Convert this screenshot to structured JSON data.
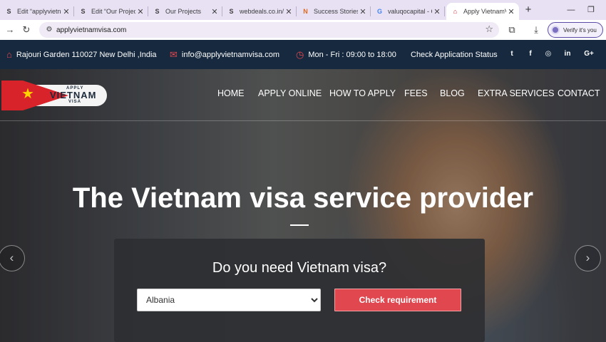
{
  "browser": {
    "tabs": [
      {
        "title": "Edit “applyvietna",
        "icon": "S"
      },
      {
        "title": "Edit “Our Projects",
        "icon": "S"
      },
      {
        "title": "Our Projects",
        "icon": "S"
      },
      {
        "title": "webdeals.co.in/p",
        "icon": "S"
      },
      {
        "title": "Success Stories",
        "icon": "N"
      },
      {
        "title": "valuqocapital - C",
        "icon": "G"
      },
      {
        "title": "Apply VietnamVi",
        "icon": "⌂"
      }
    ],
    "url": "applyvietnamvisa.com",
    "verify_label": "Verify it's you"
  },
  "infobar": {
    "address": "Rajouri Garden 110027 New Delhi ,India",
    "email": "info@applyvietnamvisa.com",
    "hours": "Mon - Fri : 09:00 to 18:00",
    "check_status": "Check Application Status",
    "social": [
      "t",
      "f",
      "◎",
      "in",
      "G+"
    ]
  },
  "logo": {
    "top": "APPLY",
    "main": "VIETNAM",
    "bottom": "VISA"
  },
  "nav": [
    "HOME",
    "APPLY ONLINE",
    "HOW TO APPLY",
    "FEES",
    "BLOG",
    "EXTRA SERVICES",
    "CONTACT"
  ],
  "hero": {
    "headline": "The Vietnam visa service provider",
    "question": "Do you need Vietnam visa?",
    "country_selected": "Albania",
    "cta": "Check requirement"
  },
  "colors": {
    "accent": "#e0474f",
    "infobar_bg": "#16293e",
    "tabstrip_bg": "#e8e1f4"
  }
}
